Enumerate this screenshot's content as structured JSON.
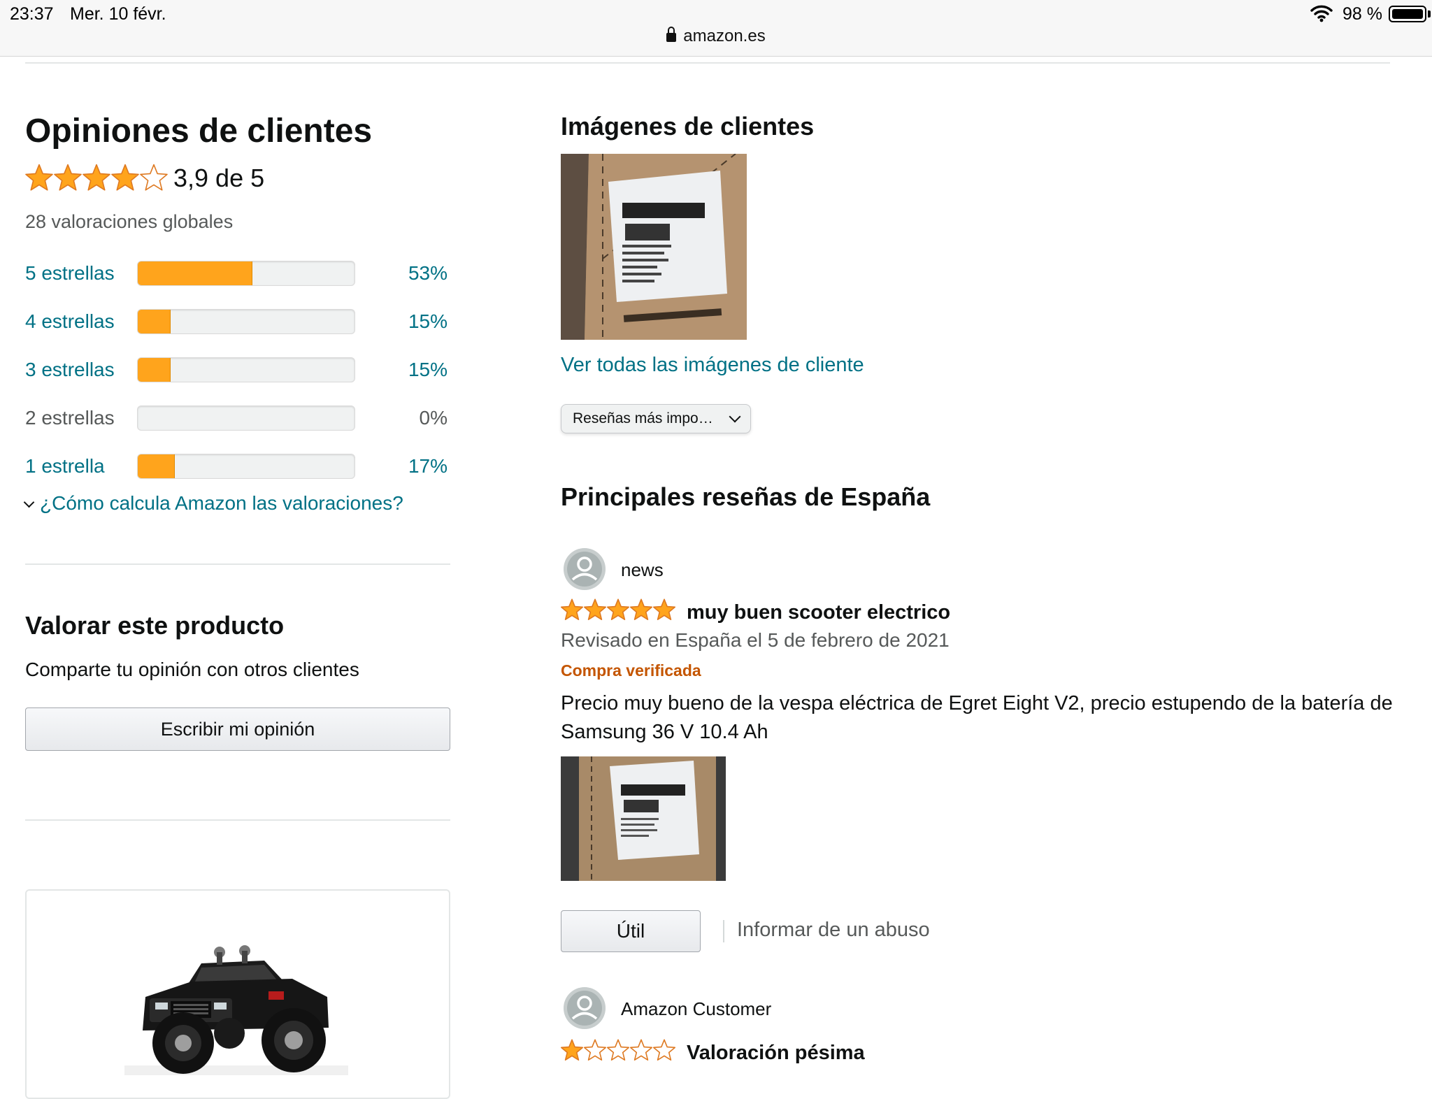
{
  "status_bar": {
    "time": "23:37",
    "date": "Mer. 10 févr.",
    "battery": "98 %",
    "url": "amazon.es"
  },
  "ratings": {
    "title": "Opiniones de clientes",
    "average_stars": 3.9,
    "average_text": "3,9 de 5",
    "total": "28 valoraciones globales",
    "histogram": [
      {
        "label": "5 estrellas",
        "percent_text": "53%",
        "percent": 53,
        "link": true
      },
      {
        "label": "4 estrellas",
        "percent_text": "15%",
        "percent": 15,
        "link": true
      },
      {
        "label": "3 estrellas",
        "percent_text": "15%",
        "percent": 15,
        "link": true
      },
      {
        "label": "2 estrellas",
        "percent_text": "0%",
        "percent": 0,
        "link": false
      },
      {
        "label": "1 estrella",
        "percent_text": "17%",
        "percent": 17,
        "link": true
      }
    ],
    "how_link": "¿Cómo calcula Amazon las valoraciones?"
  },
  "rate_product": {
    "title": "Valorar este producto",
    "subtitle": "Comparte tu opinión con otros clientes",
    "button": "Escribir mi opinión"
  },
  "customer_images": {
    "title": "Imágenes de clientes",
    "see_all": "Ver todas las imágenes de cliente"
  },
  "sort": {
    "selected": "Reseñas más impo…"
  },
  "top_reviews": {
    "title": "Principales reseñas de España",
    "reviews": [
      {
        "author": "news",
        "stars": 5,
        "title": "muy buen scooter electrico",
        "date": "Revisado en España el 5 de febrero de 2021",
        "verified": "Compra verificada",
        "body": "Precio muy bueno de la vespa eléctrica de Egret Eight V2, precio estupendo de la batería de Samsung 36 V 10.4 Ah",
        "useful": "Útil",
        "report": "Informar de un abuso"
      },
      {
        "author": "Amazon Customer",
        "stars": 1,
        "title": "Valoración pésima"
      }
    ]
  },
  "colors": {
    "star": "#ffa41c",
    "link": "#007185",
    "verified": "#c45500"
  }
}
